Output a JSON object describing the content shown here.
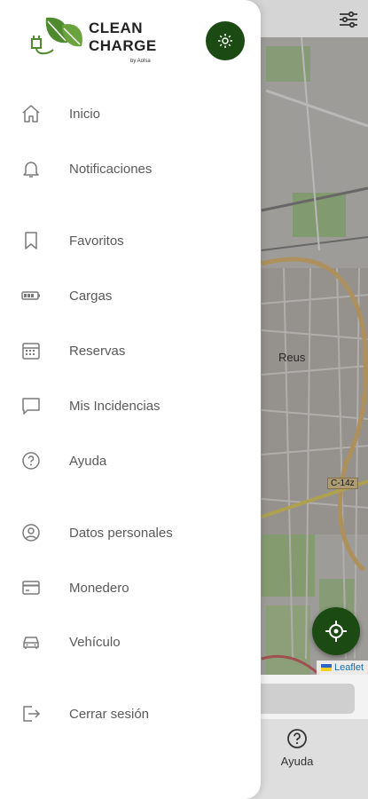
{
  "brand": {
    "line1": "CLEAN",
    "line2": "CHARGE",
    "by": "by Aolsa"
  },
  "menu": [
    {
      "label": "Inicio",
      "icon": "home-icon"
    },
    {
      "label": "Notificaciones",
      "icon": "bell-icon"
    },
    {
      "label": "Favoritos",
      "icon": "bookmark-icon"
    },
    {
      "label": "Cargas",
      "icon": "battery-icon"
    },
    {
      "label": "Reservas",
      "icon": "calendar-icon"
    },
    {
      "label": "Mis Incidencias",
      "icon": "chat-icon"
    },
    {
      "label": "Ayuda",
      "icon": "help-icon"
    },
    {
      "label": "Datos personales",
      "icon": "user-icon"
    },
    {
      "label": "Monedero",
      "icon": "card-icon"
    },
    {
      "label": "Vehículo",
      "icon": "car-icon"
    },
    {
      "label": "Cerrar sesión",
      "icon": "logout-icon"
    }
  ],
  "map": {
    "city_label": "Reus",
    "road_label": "C-14z",
    "attribution": "Leaflet"
  },
  "bottom_nav": {
    "help_label": "Ayuda"
  },
  "colors": {
    "accent": "#1c4a13",
    "leaf": "#4f8a2e",
    "text": "#5a5a5a"
  }
}
